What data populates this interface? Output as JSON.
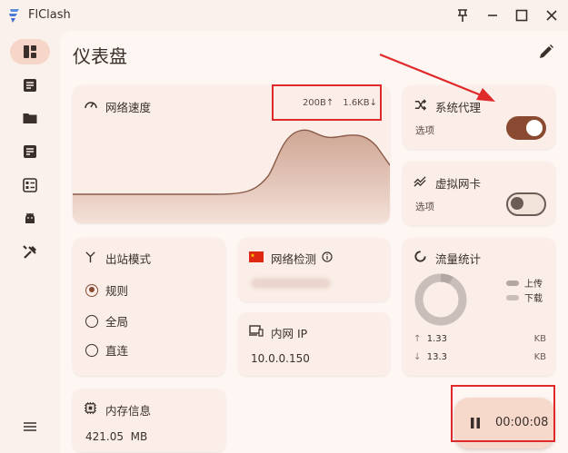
{
  "app": {
    "name": "FlClash"
  },
  "page": {
    "title": "仪表盘"
  },
  "network_speed": {
    "title": "网络速度",
    "upload": "200B",
    "download": "1.6KB",
    "up_arrow": "↑",
    "down_arrow": "↓"
  },
  "system_proxy": {
    "title": "系统代理",
    "subtitle": "选项",
    "enabled": true
  },
  "virtual_nic": {
    "title": "虚拟网卡",
    "subtitle": "选项",
    "enabled": false
  },
  "outbound_mode": {
    "title": "出站模式",
    "options": [
      "规则",
      "全局",
      "直连"
    ],
    "selected": "规则"
  },
  "network_check": {
    "title": "网络检测"
  },
  "intranet_ip": {
    "title": "内网 IP",
    "value": "10.0.0.150"
  },
  "traffic_stats": {
    "title": "流量统计",
    "legend_upload": "上传",
    "legend_download": "下载",
    "upload_value": "1.33",
    "upload_unit": "KB",
    "download_value": "13.3",
    "download_unit": "KB"
  },
  "memory_info": {
    "title": "内存信息",
    "value": "421.05  MB"
  },
  "timer": {
    "elapsed": "00:00:08"
  },
  "colors": {
    "accent": "#8a4a32",
    "highlight_red": "#e0292b",
    "card_bg": "#fbeee8"
  },
  "icons": {
    "logo": "flclash-logo-icon",
    "pin": "pin-icon",
    "minimize": "minimize-icon",
    "maximize": "maximize-icon",
    "close": "close-icon",
    "edit": "pencil-icon"
  }
}
